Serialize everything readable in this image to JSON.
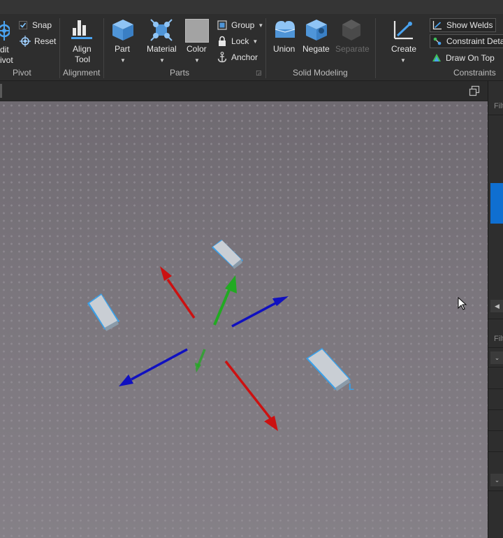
{
  "ribbon": {
    "pivot": {
      "edit_label_line1": "dit",
      "edit_label_line2": "ivot",
      "snap": "Snap",
      "reset": "Reset",
      "group_label": "Pivot"
    },
    "alignment": {
      "tool_line1": "Align",
      "tool_line2": "Tool",
      "group_label": "Alignment"
    },
    "parts": {
      "part": "Part",
      "material": "Material",
      "color": "Color",
      "group": "Group",
      "lock": "Lock",
      "anchor": "Anchor",
      "group_label": "Parts"
    },
    "solid_modeling": {
      "union": "Union",
      "negate": "Negate",
      "separate": "Separate",
      "group_label": "Solid Modeling"
    },
    "constraints": {
      "create": "Create",
      "show_welds": "Show Welds",
      "constraint_details": "Constraint Detai",
      "draw_on_top": "Draw On Top",
      "group_label": "Constraints"
    }
  },
  "right_panel": {
    "filter_top": "Filt",
    "filter_bottom": "Filt"
  },
  "viewport": {
    "constraint_marker": "L",
    "colors": {
      "axis_x": "#cc1111",
      "axis_y": "#22aa22",
      "axis_z": "#1010c0",
      "part_fill": "#c9ced4",
      "part_outline": "#3aa0e8"
    }
  }
}
